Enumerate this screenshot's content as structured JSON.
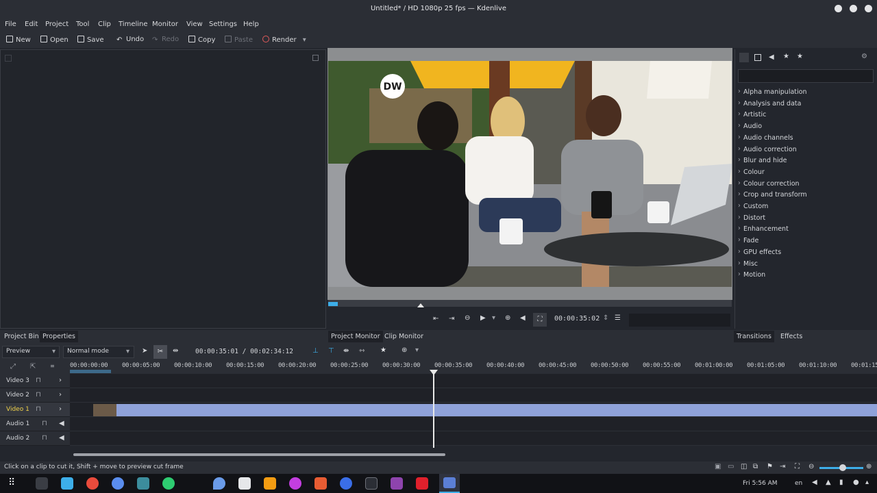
{
  "window": {
    "title": "Untitled* / HD 1080p 25 fps — Kdenlive"
  },
  "menu": [
    "File",
    "Edit",
    "Project",
    "Tool",
    "Clip",
    "Timeline",
    "Monitor",
    "View",
    "Settings",
    "Help"
  ],
  "toolbar": {
    "new": "New",
    "open": "Open",
    "save": "Save",
    "undo": "Undo",
    "redo": "Redo",
    "copy": "Copy",
    "paste": "Paste",
    "render": "Render"
  },
  "monitor": {
    "timecode": "00:00:35:02",
    "overlay_logo": "DW"
  },
  "effects": {
    "categories": [
      "Alpha manipulation",
      "Analysis and data",
      "Artistic",
      "Audio",
      "Audio channels",
      "Audio correction",
      "Blur and hide",
      "Colour",
      "Colour correction",
      "Crop and transform",
      "Custom",
      "Distort",
      "Enhancement",
      "Fade",
      "GPU effects",
      "Misc",
      "Motion"
    ]
  },
  "tabs": {
    "project_bin": "Project Bin",
    "properties": "Properties",
    "project_monitor": "Project Monitor",
    "clip_monitor": "Clip Monitor",
    "transitions": "Transitions",
    "effects": "Effects"
  },
  "timeline": {
    "preview_label": "Preview",
    "mode_label": "Normal mode",
    "position": "00:00:35:01 / 00:02:34:12",
    "ruler": [
      "00:00:00:00",
      "00:00:05:00",
      "00:00:10:00",
      "00:00:15:00",
      "00:00:20:00",
      "00:00:25:00",
      "00:00:30:00",
      "00:00:35:00",
      "00:00:40:00",
      "00:00:45:00",
      "00:00:50:00",
      "00:00:55:00",
      "00:01:00:00",
      "00:01:05:00",
      "00:01:10:00",
      "00:01:15"
    ],
    "tracks": [
      "Video 3",
      "Video 2",
      "Video 1",
      "Audio 1",
      "Audio 2"
    ]
  },
  "status": {
    "message": "Click on a clip to cut it, Shift + move to preview cut frame"
  },
  "taskbar": {
    "clock": "Fri 5:56 AM",
    "lang": "en"
  },
  "colors": {
    "accent": "#3daee9",
    "clip": "#8fa2d9",
    "playhead": "#e8e8e8"
  }
}
